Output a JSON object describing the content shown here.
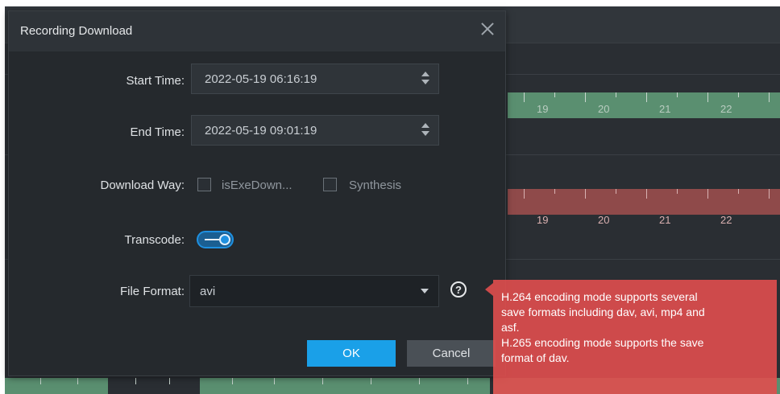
{
  "dialog": {
    "title": "Recording Download",
    "start_time": {
      "label": "Start Time:",
      "value": "2022-05-19 06:16:19"
    },
    "end_time": {
      "label": "End Time:",
      "value": "2022-05-19 09:01:19"
    },
    "download_way": {
      "label": "Download Way:",
      "options": [
        {
          "label": "isExeDown...",
          "checked": false
        },
        {
          "label": "Synthesis",
          "checked": false
        }
      ]
    },
    "transcode": {
      "label": "Transcode:",
      "enabled": true
    },
    "file_format": {
      "label": "File Format:",
      "value": "avi"
    },
    "ok_label": "OK",
    "cancel_label": "Cancel"
  },
  "tooltip": {
    "lines": [
      "H.264 encoding mode supports several",
      "save formats including dav, avi, mp4 and",
      "asf.",
      "H.265 encoding mode supports the save",
      "format of dav."
    ]
  },
  "timeline": {
    "track1_hours": [
      "19",
      "20",
      "21",
      "22"
    ],
    "track2_hours": [
      "19",
      "20",
      "21",
      "22"
    ]
  },
  "colors": {
    "accent": "#1aa0e8",
    "recording_track": "#5a8f70",
    "alarm_track": "#8f4a4a",
    "tooltip_bg": "#e04e4e"
  }
}
